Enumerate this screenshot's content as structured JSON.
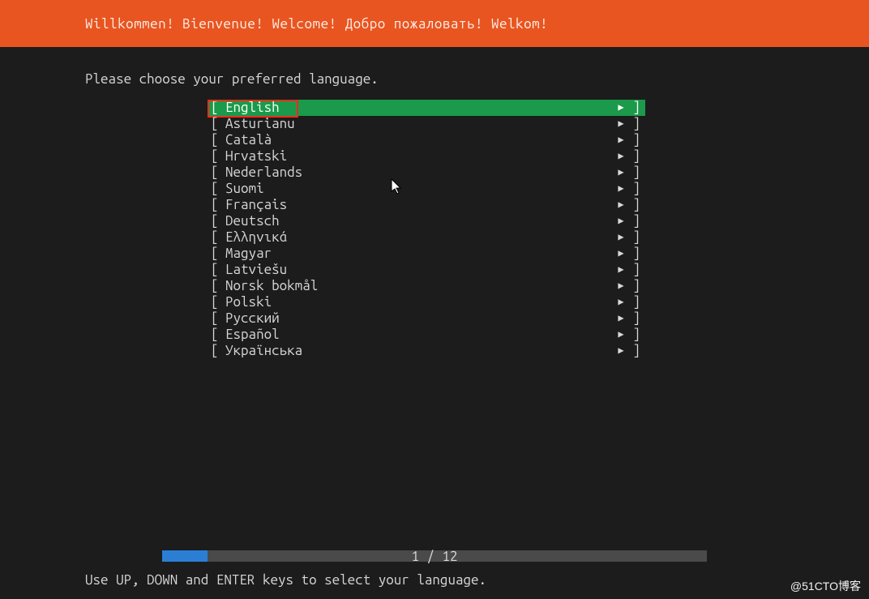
{
  "header": {
    "title": "Willkommen! Bienvenue! Welcome! Добро пожаловать! Welkom!"
  },
  "prompt": "Please choose your preferred language.",
  "menu": {
    "selected_index": 0,
    "items": [
      "English",
      "Asturianu",
      "Català",
      "Hrvatski",
      "Nederlands",
      "Suomi",
      "Français",
      "Deutsch",
      "Ελληνικά",
      "Magyar",
      "Latviešu",
      "Norsk bokmål",
      "Polski",
      "Русский",
      "Español",
      "Українська"
    ]
  },
  "progress": {
    "current": 1,
    "total": 12,
    "label": "1 / 12"
  },
  "footer": {
    "hint": "Use UP, DOWN and ENTER keys to select your language."
  },
  "watermark": "@51CTO博客",
  "colors": {
    "header_bg": "#e95520",
    "selected_bg": "#1a9a4a",
    "progress_fill": "#2a7fd4",
    "highlight_border": "#ff2a1a"
  }
}
